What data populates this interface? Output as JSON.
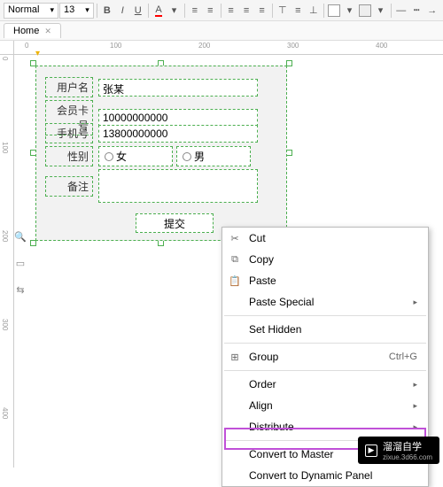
{
  "toolbar": {
    "style_dropdown": "Normal",
    "font_size": "13"
  },
  "tabs": [
    {
      "label": "Home"
    }
  ],
  "ruler_h": [
    "0",
    "100",
    "200",
    "300",
    "400"
  ],
  "ruler_v": [
    "0",
    "100",
    "200",
    "300",
    "400"
  ],
  "form": {
    "labels": {
      "username": "用户名",
      "card": "会员卡号",
      "phone": "手机号",
      "gender": "性别",
      "note": "备注"
    },
    "values": {
      "username": "张某",
      "card": "10000000000",
      "phone": "13800000000"
    },
    "radios": {
      "female": "女",
      "male": "男"
    },
    "submit": "提交"
  },
  "ctx": {
    "cut": "Cut",
    "copy": "Copy",
    "paste": "Paste",
    "paste_special": "Paste Special",
    "set_hidden": "Set Hidden",
    "group": "Group",
    "group_shortcut": "Ctrl+G",
    "order": "Order",
    "align": "Align",
    "distribute": "Distribute",
    "convert_master": "Convert to Master",
    "convert_dynamic": "Convert to Dynamic Panel"
  },
  "watermark": {
    "title": "溜溜自学",
    "url": "zixue.3d66.com"
  }
}
